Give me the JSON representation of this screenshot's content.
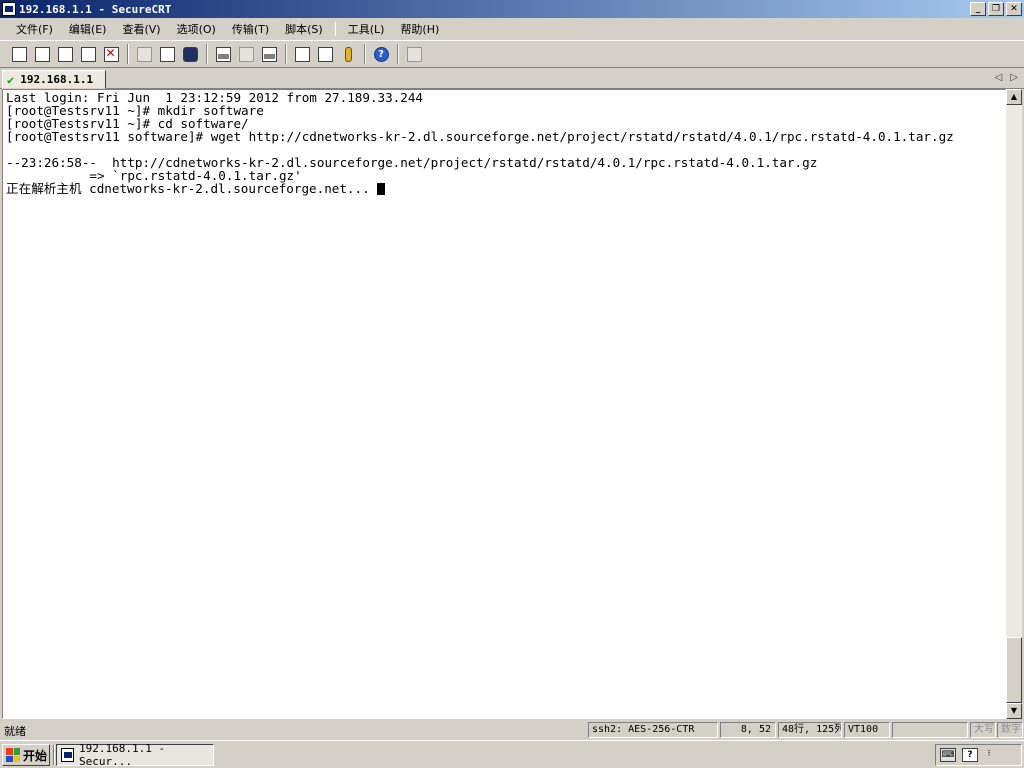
{
  "window": {
    "title": "192.168.1.1 - SecureCRT",
    "controls": {
      "minimize": "_",
      "maximize": "❐",
      "close": "✕"
    }
  },
  "menu": {
    "items": [
      "文件(F)",
      "编辑(E)",
      "查看(V)",
      "选项(O)",
      "传输(T)",
      "脚本(S)",
      "工具(L)",
      "帮助(H)"
    ]
  },
  "toolbar": {
    "icons": [
      "connect-icon",
      "quick-connect-icon",
      "connect-in-tab-icon",
      "reconnect-icon",
      "disconnect-icon",
      "copy-icon",
      "paste-icon",
      "find-icon",
      "print-screen-icon",
      "print-selection-icon",
      "print-setup-icon",
      "session-options-icon",
      "global-options-icon",
      "keymap-icon",
      "help-icon",
      "sftp-icon"
    ]
  },
  "tab": {
    "label": "192.168.1.1",
    "status_icon": "connected-check-icon"
  },
  "terminal": {
    "lines": [
      "Last login: Fri Jun  1 23:12:59 2012 from 27.189.33.244",
      "[root@Testsrv11 ~]# mkdir software",
      "[root@Testsrv11 ~]# cd software/",
      "[root@Testsrv11 software]# wget http://cdnetworks-kr-2.dl.sourceforge.net/project/rstatd/rstatd/4.0.1/rpc.rstatd-4.0.1.tar.gz",
      "",
      "--23:26:58--  http://cdnetworks-kr-2.dl.sourceforge.net/project/rstatd/rstatd/4.0.1/rpc.rstatd-4.0.1.tar.gz",
      "           => `rpc.rstatd-4.0.1.tar.gz'",
      "正在解析主机 cdnetworks-kr-2.dl.sourceforge.net... "
    ]
  },
  "statusbar": {
    "ready": "就绪",
    "cipher": "ssh2: AES-256-CTR",
    "cursor_pos": "8,  52",
    "size": "48行, 125列",
    "emulation": "VT100",
    "blank": "",
    "caps": "大写",
    "num": "数字"
  },
  "taskbar": {
    "start_label": "开始",
    "task_label": "192.168.1.1 - Secur...",
    "tray_icons": [
      "keyboard-icon",
      "help-icon",
      "language-icon"
    ]
  }
}
